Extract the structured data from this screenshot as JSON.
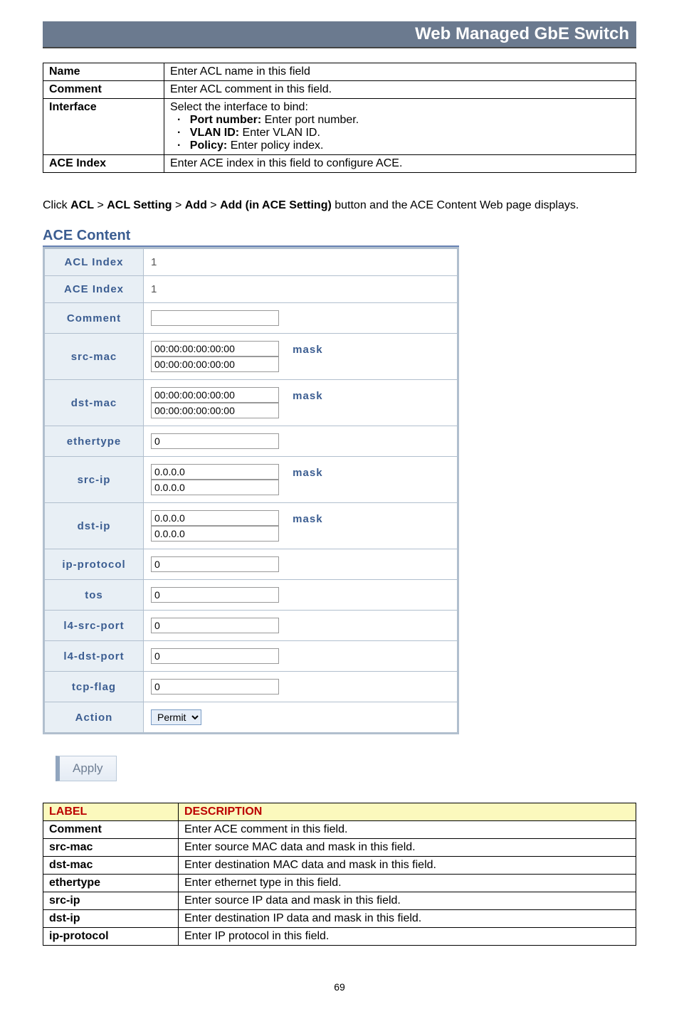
{
  "header": {
    "title": "Web Managed GbE Switch"
  },
  "table1": {
    "rows": [
      {
        "label": "Name",
        "desc": "Enter ACL name in this field"
      },
      {
        "label": "Comment",
        "desc": "Enter ACL comment in this field."
      },
      {
        "label": "Interface",
        "desc": "Select the interface to bind:",
        "items": [
          {
            "bold": "Port number:",
            "rest": " Enter port number."
          },
          {
            "bold": "VLAN ID:",
            "rest": " Enter VLAN ID."
          },
          {
            "bold": "Policy:",
            "rest": " Enter policy index."
          }
        ]
      },
      {
        "label": "ACE Index",
        "desc": "Enter ACE index in this field to configure ACE."
      }
    ]
  },
  "instruction": {
    "prefix": "Click ",
    "b1": "ACL",
    "s1": " > ",
    "b2": "ACL Setting",
    "s2": " > ",
    "b3": "Add",
    "s3": " > ",
    "b4": "Add (in ACE Setting)",
    "suffix": " button and the ACE Content Web page displays."
  },
  "ace": {
    "title": "ACE Content",
    "rows": {
      "acl_index": {
        "label": "ACL Index",
        "value": "1"
      },
      "ace_index": {
        "label": "ACE Index",
        "value": "1"
      },
      "comment": {
        "label": "Comment",
        "value": ""
      },
      "src_mac": {
        "label": "src-mac",
        "value": "00:00:00:00:00:00",
        "mask_label": "mask",
        "mask_value": "00:00:00:00:00:00"
      },
      "dst_mac": {
        "label": "dst-mac",
        "value": "00:00:00:00:00:00",
        "mask_label": "mask",
        "mask_value": "00:00:00:00:00:00"
      },
      "ethertype": {
        "label": "ethertype",
        "value": "0"
      },
      "src_ip": {
        "label": "src-ip",
        "value": "0.0.0.0",
        "mask_label": "mask",
        "mask_value": "0.0.0.0"
      },
      "dst_ip": {
        "label": "dst-ip",
        "value": "0.0.0.0",
        "mask_label": "mask",
        "mask_value": "0.0.0.0"
      },
      "ip_protocol": {
        "label": "ip-protocol",
        "value": "0"
      },
      "tos": {
        "label": "tos",
        "value": "0"
      },
      "l4_src_port": {
        "label": "l4-src-port",
        "value": "0"
      },
      "l4_dst_port": {
        "label": "l4-dst-port",
        "value": "0"
      },
      "tcp_flag": {
        "label": "tcp-flag",
        "value": "0"
      },
      "action": {
        "label": "Action",
        "value": "Permit"
      }
    },
    "apply_label": "Apply"
  },
  "table2": {
    "headers": {
      "label": "LABEL",
      "desc": "DESCRIPTION"
    },
    "rows": [
      {
        "label": "Comment",
        "desc": "Enter ACE comment in this field."
      },
      {
        "label": "src-mac",
        "desc": "Enter source MAC data and mask in this field."
      },
      {
        "label": "dst-mac",
        "desc": "Enter destination MAC data and mask in this field."
      },
      {
        "label": "ethertype",
        "desc": "Enter ethernet type in this field."
      },
      {
        "label": "src-ip",
        "desc": "Enter source IP data and mask in this field."
      },
      {
        "label": "dst-ip",
        "desc": "Enter destination IP data and mask in this field."
      },
      {
        "label": "ip-protocol",
        "desc": "Enter IP protocol in this field."
      }
    ]
  },
  "page_number": "69"
}
